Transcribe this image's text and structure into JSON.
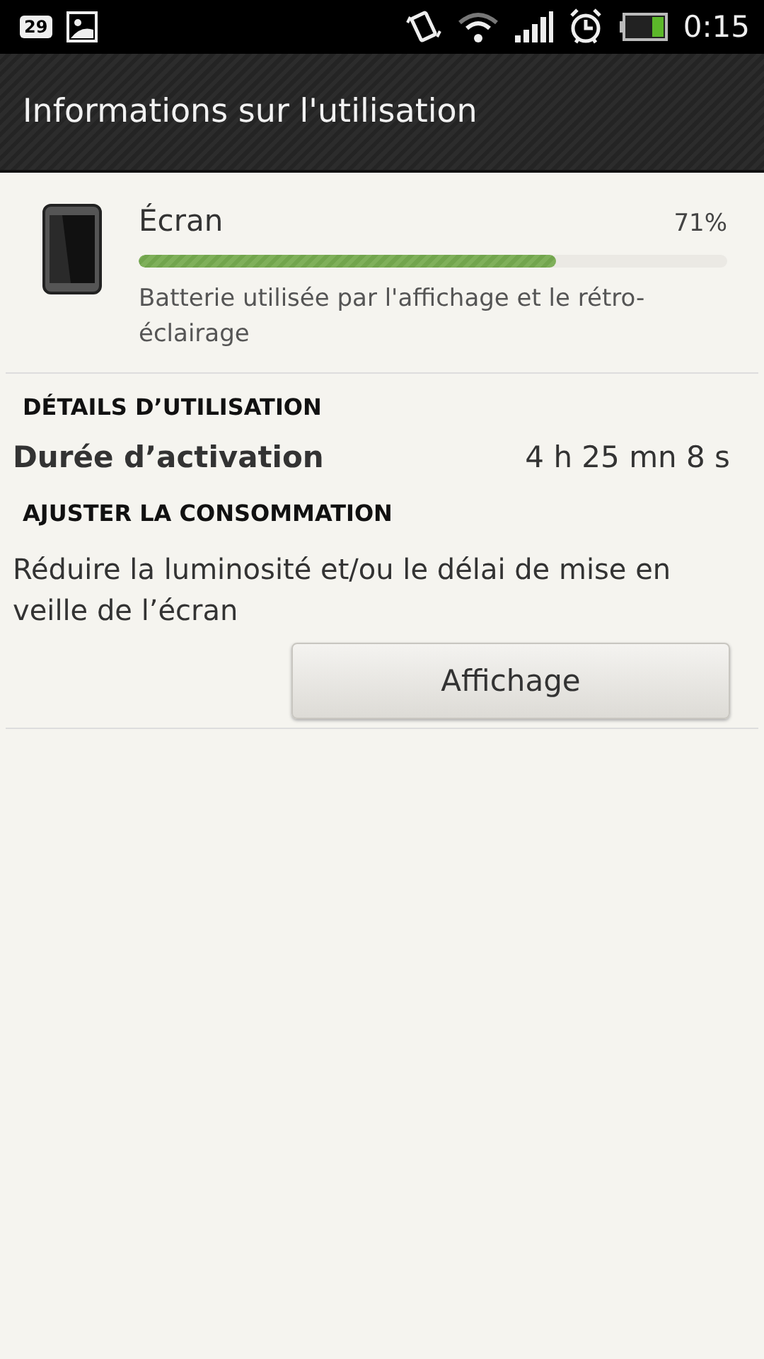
{
  "status_bar": {
    "notification_count": "29",
    "time": "0:15"
  },
  "title_bar": {
    "title": "Informations sur l'utilisation"
  },
  "usage": {
    "name": "Écran",
    "percent": "71%",
    "level": 0.71,
    "description": "Batterie utilisée par l'affichage et le rétro-éclairage"
  },
  "details": {
    "heading": "DÉTAILS D’UTILISATION",
    "rows": [
      {
        "label": "Durée d’activation",
        "value": "4 h 25 mn 8 s"
      }
    ]
  },
  "adjust": {
    "heading": "AJUSTER LA CONSOMMATION",
    "text": "Réduire la luminosité et/ou le délai de mise en veille de l’écran",
    "button": "Affichage"
  }
}
